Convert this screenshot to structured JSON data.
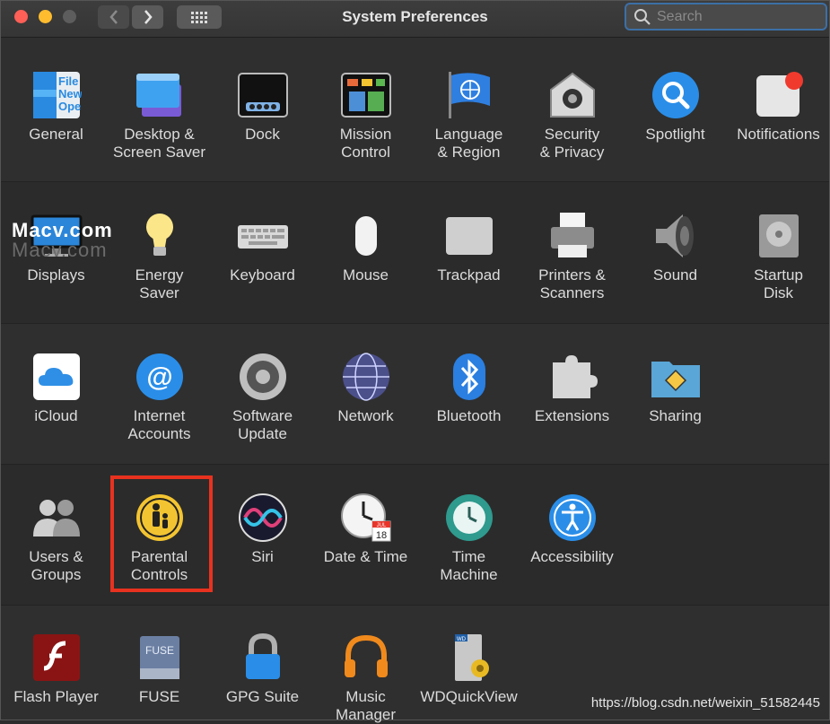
{
  "window": {
    "title": "System Preferences"
  },
  "search": {
    "placeholder": "Search"
  },
  "watermark": "Macv.com",
  "credit": "https://blog.csdn.net/weixin_51582445",
  "rows": [
    [
      {
        "label": "General",
        "icon": "general-icon"
      },
      {
        "label": "Desktop &\nScreen Saver",
        "icon": "desktop-icon"
      },
      {
        "label": "Dock",
        "icon": "dock-icon"
      },
      {
        "label": "Mission\nControl",
        "icon": "mission-control-icon"
      },
      {
        "label": "Language\n& Region",
        "icon": "language-icon"
      },
      {
        "label": "Security\n& Privacy",
        "icon": "security-icon"
      },
      {
        "label": "Spotlight",
        "icon": "spotlight-icon"
      },
      {
        "label": "Notifications",
        "icon": "notifications-icon"
      }
    ],
    [
      {
        "label": "Displays",
        "icon": "displays-icon"
      },
      {
        "label": "Energy\nSaver",
        "icon": "energy-icon"
      },
      {
        "label": "Keyboard",
        "icon": "keyboard-icon"
      },
      {
        "label": "Mouse",
        "icon": "mouse-icon"
      },
      {
        "label": "Trackpad",
        "icon": "trackpad-icon"
      },
      {
        "label": "Printers &\nScanners",
        "icon": "printer-icon"
      },
      {
        "label": "Sound",
        "icon": "sound-icon"
      },
      {
        "label": "Startup\nDisk",
        "icon": "disk-icon"
      }
    ],
    [
      {
        "label": "iCloud",
        "icon": "icloud-icon"
      },
      {
        "label": "Internet\nAccounts",
        "icon": "at-icon"
      },
      {
        "label": "Software\nUpdate",
        "icon": "gear-icon"
      },
      {
        "label": "Network",
        "icon": "globe-icon"
      },
      {
        "label": "Bluetooth",
        "icon": "bluetooth-icon"
      },
      {
        "label": "Extensions",
        "icon": "puzzle-icon"
      },
      {
        "label": "Sharing",
        "icon": "sharing-icon"
      }
    ],
    [
      {
        "label": "Users &\nGroups",
        "icon": "users-icon"
      },
      {
        "label": "Parental\nControls",
        "icon": "parental-icon"
      },
      {
        "label": "Siri",
        "icon": "siri-icon"
      },
      {
        "label": "Date & Time",
        "icon": "clock-icon"
      },
      {
        "label": "Time\nMachine",
        "icon": "time-machine-icon"
      },
      {
        "label": "Accessibility",
        "icon": "accessibility-icon"
      }
    ],
    [
      {
        "label": "Flash Player",
        "icon": "flash-icon"
      },
      {
        "label": "FUSE",
        "icon": "fuse-icon"
      },
      {
        "label": "GPG Suite",
        "icon": "lock-icon"
      },
      {
        "label": "Music\nManager",
        "icon": "headphones-icon"
      },
      {
        "label": "WDQuickView",
        "icon": "wd-icon"
      }
    ]
  ],
  "icon_texts": {
    "general": "File\nNew\nOpe",
    "calendar_month": "JUL",
    "calendar_day": "18",
    "fuse": "FUSE",
    "wd": "WD"
  }
}
